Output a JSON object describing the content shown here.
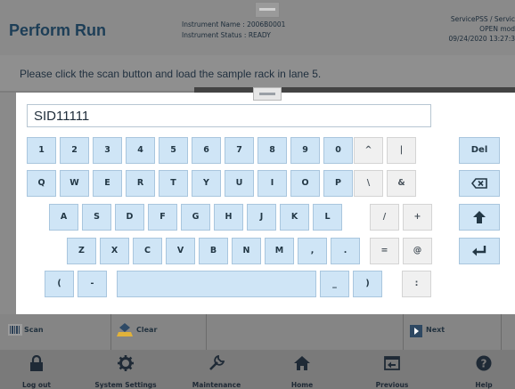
{
  "header": {
    "title": "Perform Run",
    "instrument_name": "Instrument Name : 2006B0001",
    "instrument_status": "Instrument Status : READY",
    "user": "ServicePSS / Servic",
    "mode": "OPEN mod",
    "datetime": "09/24/2020 13:27:3"
  },
  "instruction": "Please click the scan button and load the sample rack in lane 5.",
  "keyboard": {
    "input_value": "SID11111",
    "row1": [
      "1",
      "2",
      "3",
      "4",
      "5",
      "6",
      "7",
      "8",
      "9",
      "0"
    ],
    "row1_sym": [
      "^",
      "|"
    ],
    "del_label": "Del",
    "row2": [
      "Q",
      "W",
      "E",
      "R",
      "T",
      "Y",
      "U",
      "I",
      "O",
      "P"
    ],
    "row2_sym": [
      "\\",
      "&"
    ],
    "row3": [
      "A",
      "S",
      "D",
      "F",
      "G",
      "H",
      "J",
      "K",
      "L"
    ],
    "row3_sym": [
      "/",
      "+"
    ],
    "row4": [
      "Z",
      "X",
      "C",
      "V",
      "B",
      "N",
      "M",
      ",",
      "."
    ],
    "row4_sym": [
      "=",
      "@"
    ],
    "row5_left": [
      "(",
      "-"
    ],
    "row5_right": [
      "_",
      ")"
    ],
    "row5_sym": [
      ":"
    ]
  },
  "actions": {
    "scan": "Scan",
    "clear": "Clear",
    "next": "Next"
  },
  "nav": [
    {
      "label": "Log out",
      "icon": "lock-icon"
    },
    {
      "label": "System Settings",
      "icon": "gear-icon"
    },
    {
      "label": "Maintenance",
      "icon": "wrench-icon"
    },
    {
      "label": "Home",
      "icon": "home-icon"
    },
    {
      "label": "Previous",
      "icon": "previous-screen-icon"
    },
    {
      "label": "Help",
      "icon": "help-icon"
    }
  ]
}
